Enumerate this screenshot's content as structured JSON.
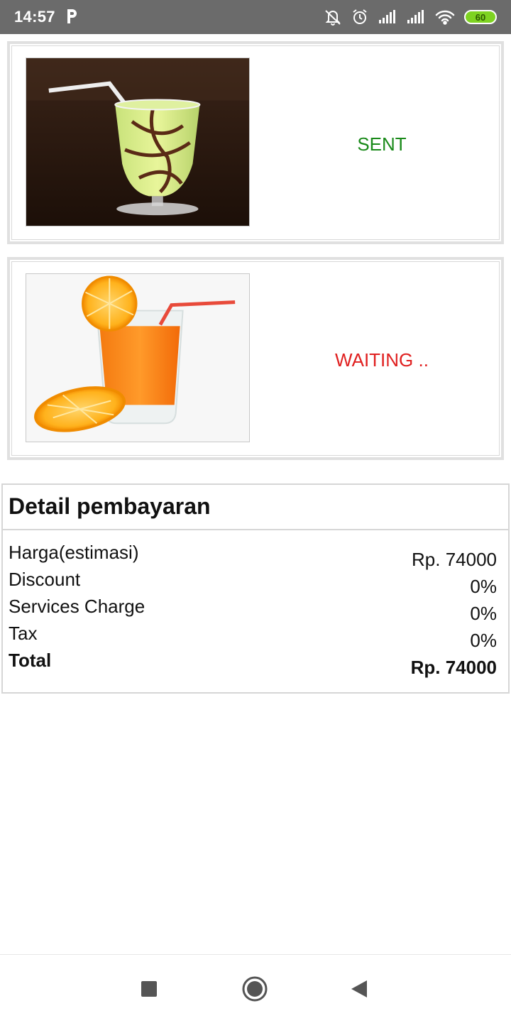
{
  "status_bar": {
    "time": "14:57",
    "battery_level": "60",
    "icons": [
      "parking-icon",
      "bell-off-icon",
      "alarm-icon",
      "signal-icon",
      "signal-icon",
      "wifi-icon",
      "battery-icon"
    ],
    "battery_color": "#7ed321"
  },
  "orders": [
    {
      "image_icon": "avocado-juice-image",
      "status": "SENT",
      "status_color": "#1a8a1a"
    },
    {
      "image_icon": "orange-juice-image",
      "status": "WAITING ..",
      "status_color": "#e02020"
    }
  ],
  "payment": {
    "title": "Detail pembayaran",
    "rows": [
      {
        "label": "Harga(estimasi)",
        "value": "Rp. 74000"
      },
      {
        "label": "Discount",
        "value": "0%"
      },
      {
        "label": "Services Charge",
        "value": "0%"
      },
      {
        "label": "Tax",
        "value": "0%"
      },
      {
        "label": "Total",
        "value": "Rp. 74000"
      }
    ]
  },
  "nav": {
    "icons": [
      "recents-square-icon",
      "home-circle-icon",
      "back-triangle-icon"
    ]
  }
}
